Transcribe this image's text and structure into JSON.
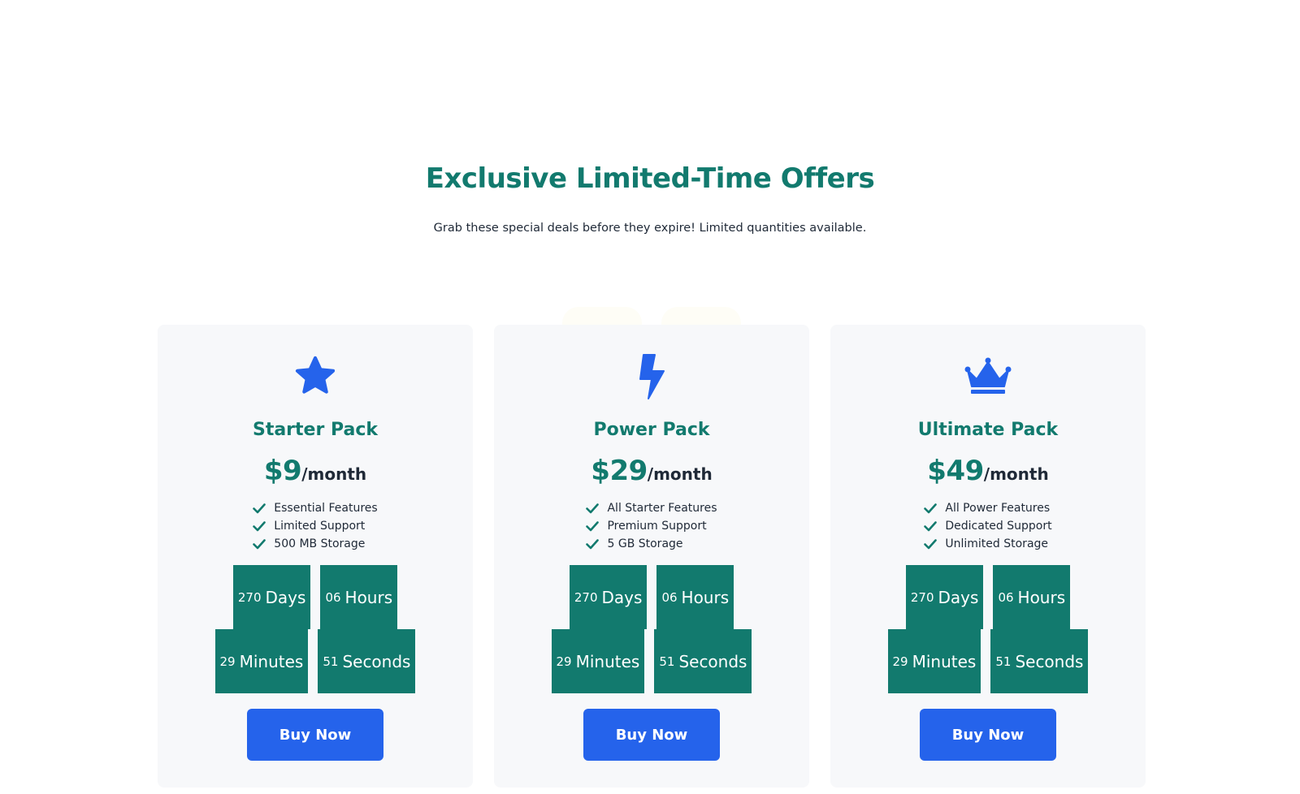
{
  "hero": {
    "title": "Exclusive Limited-Time Offers",
    "subtitle": "Grab these special deals before they expire! Limited quantities available."
  },
  "colors": {
    "primary_teal": "#127a6e",
    "accent_blue": "#2563eb",
    "card_bg": "#f7f8fa",
    "text_dark": "#1f2937"
  },
  "cards": [
    {
      "icon": "star-icon",
      "title": "Starter Pack",
      "price": "$9",
      "period": "/month",
      "features": [
        "Essential Features",
        "Limited Support",
        "500 MB Storage"
      ],
      "countdown": {
        "days": "270",
        "days_label": "Days",
        "hours": "06",
        "hours_label": "Hours",
        "minutes": "29",
        "minutes_label": "Minutes",
        "seconds": "51",
        "seconds_label": "Seconds"
      },
      "cta": "Buy Now"
    },
    {
      "icon": "lightning-bolt-icon",
      "title": "Power Pack",
      "price": "$29",
      "period": "/month",
      "features": [
        "All Starter Features",
        "Premium Support",
        "5 GB Storage"
      ],
      "countdown": {
        "days": "270",
        "days_label": "Days",
        "hours": "06",
        "hours_label": "Hours",
        "minutes": "29",
        "minutes_label": "Minutes",
        "seconds": "51",
        "seconds_label": "Seconds"
      },
      "cta": "Buy Now"
    },
    {
      "icon": "crown-icon",
      "title": "Ultimate Pack",
      "price": "$49",
      "period": "/month",
      "features": [
        "All Power Features",
        "Dedicated Support",
        "Unlimited Storage"
      ],
      "countdown": {
        "days": "270",
        "days_label": "Days",
        "hours": "06",
        "hours_label": "Hours",
        "minutes": "29",
        "minutes_label": "Minutes",
        "seconds": "51",
        "seconds_label": "Seconds"
      },
      "cta": "Buy Now"
    }
  ]
}
